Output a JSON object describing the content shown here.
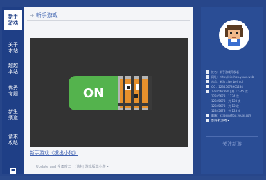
{
  "nav": {
    "items": [
      {
        "label": "新手\n游戏",
        "active": true
      },
      {
        "label": "关于\n本站",
        "active": false
      },
      {
        "label": "超越\n本站",
        "active": false
      },
      {
        "label": "优秀\n专题",
        "active": false
      },
      {
        "label": "新生\n须道",
        "active": false
      },
      {
        "label": "请求\n攻略",
        "active": false
      }
    ],
    "bottom_icon": "book-icon"
  },
  "main": {
    "title": "新手游戏",
    "toggle_label": "ON",
    "caption": "新手游戏《拔出小狗》",
    "footnote": "Update and 全角度二十分钟 | 游戏版本小游 •"
  },
  "profile": {
    "rows": [
      {
        "icon": "user-icon",
        "text": "姓名：新手游戏开发者"
      },
      {
        "icon": "link-icon",
        "text": "网址：http://xinshou.youxi.web"
      },
      {
        "icon": "home-icon",
        "text": "出品：新游 xiao_bei_dui"
      },
      {
        "icon": "star-icon",
        "text": "QQ：12345678901234"
      },
      {
        "icon": "chart-icon",
        "text": "1234567890 | 共 12345 次"
      },
      {
        "icon": "",
        "text": "12345678 | 1234 次"
      },
      {
        "icon": "",
        "text": "12345678 | 共 123 次"
      },
      {
        "icon": "",
        "text": "12345678 | 共 12 次"
      },
      {
        "icon": "",
        "text": "12345678 | 共 123 次"
      },
      {
        "icon": "mail-icon",
        "text": "邮箱：xx@xinshou.youxi.com"
      },
      {
        "icon": "wechat-icon",
        "text": "加好友游戏 ▸",
        "highlight": true
      }
    ],
    "follow_label": "关注新游"
  },
  "colors": {
    "frame": "#27468a",
    "nav": "#1f3f86",
    "accent": "#4a6db5",
    "toggle_green": "#54b34d",
    "stage": "#333333"
  }
}
